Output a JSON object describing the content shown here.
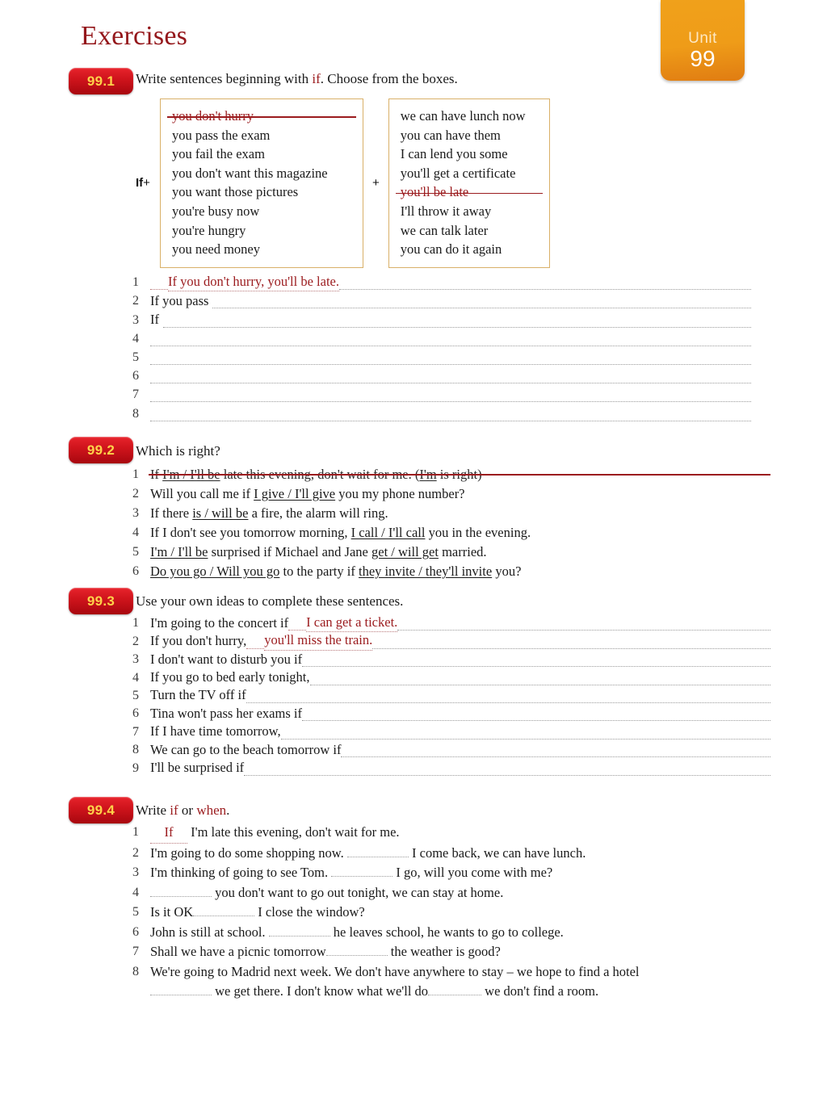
{
  "unit": {
    "word": "Unit",
    "number": "99"
  },
  "page": {
    "title": "Exercises"
  },
  "colors": {
    "title_red": "#94171b",
    "badge_red": "#cf141c",
    "badge_text_gold": "#ffd24a",
    "unit_orange": "#ef9c18",
    "box_border_gold": "#d9b068",
    "answer_red": "#9b1b1e"
  },
  "ex1": {
    "number": "99.1",
    "instruction_pre": "Write sentences beginning with ",
    "instruction_keyword": "if",
    "instruction_post": ".  Choose from the boxes.",
    "if_label": "If",
    "plus": "+",
    "mid_plus": "+",
    "left_box": [
      {
        "text": "you don't hurry",
        "struck": true
      },
      {
        "text": "you pass the exam",
        "struck": false
      },
      {
        "text": "you fail the exam",
        "struck": false
      },
      {
        "text": "you don't want this magazine",
        "struck": false
      },
      {
        "text": "you want those pictures",
        "struck": false
      },
      {
        "text": "you're busy now",
        "struck": false
      },
      {
        "text": "you're hungry",
        "struck": false
      },
      {
        "text": "you need money",
        "struck": false
      }
    ],
    "right_box": [
      {
        "text": "we can have lunch now",
        "struck": false
      },
      {
        "text": "you can have them",
        "struck": false
      },
      {
        "text": "I can lend you some",
        "struck": false
      },
      {
        "text": "you'll get a certificate",
        "struck": false
      },
      {
        "text": "you'll be late",
        "struck": true
      },
      {
        "text": "I'll throw it away",
        "struck": false
      },
      {
        "text": "we can talk later",
        "struck": false
      },
      {
        "text": "you can do it again",
        "struck": false
      }
    ],
    "items": [
      {
        "n": "1",
        "prompt": "",
        "answer": "If you don't hurry, you'll be late."
      },
      {
        "n": "2",
        "prompt": "If you pass",
        "answer": ""
      },
      {
        "n": "3",
        "prompt": "If",
        "answer": ""
      },
      {
        "n": "4",
        "prompt": "",
        "answer": ""
      },
      {
        "n": "5",
        "prompt": "",
        "answer": ""
      },
      {
        "n": "6",
        "prompt": "",
        "answer": ""
      },
      {
        "n": "7",
        "prompt": "",
        "answer": ""
      },
      {
        "n": "8",
        "prompt": "",
        "answer": ""
      }
    ]
  },
  "ex2": {
    "number": "99.2",
    "instruction": "Which is right?",
    "items": [
      {
        "n": "1",
        "struck": true,
        "parts": [
          {
            "t": "If ",
            "u": false
          },
          {
            "t": "I'm /  I'll be",
            "u": true
          },
          {
            "t": " late this evening, don't wait for me.     (",
            "u": false
          },
          {
            "t": "I'm",
            "u": true
          },
          {
            "t": " is right)",
            "u": false
          }
        ]
      },
      {
        "n": "2",
        "struck": false,
        "parts": [
          {
            "t": "Will you call me if ",
            "u": false
          },
          {
            "t": "I give / I'll give",
            "u": true
          },
          {
            "t": " you my phone number?",
            "u": false
          }
        ]
      },
      {
        "n": "3",
        "struck": false,
        "parts": [
          {
            "t": "If there ",
            "u": false
          },
          {
            "t": "is / will be",
            "u": true
          },
          {
            "t": " a fire, the alarm will ring.",
            "u": false
          }
        ]
      },
      {
        "n": "4",
        "struck": false,
        "parts": [
          {
            "t": "If I don't see you tomorrow morning, ",
            "u": false
          },
          {
            "t": "I call / I'll call",
            "u": true
          },
          {
            "t": " you in the evening.",
            "u": false
          }
        ]
      },
      {
        "n": "5",
        "struck": false,
        "parts": [
          {
            "t": "I'm / I'll be",
            "u": true
          },
          {
            "t": " surprised if Michael and Jane ",
            "u": false
          },
          {
            "t": "get / will get",
            "u": true
          },
          {
            "t": " married.",
            "u": false
          }
        ]
      },
      {
        "n": "6",
        "struck": false,
        "parts": [
          {
            "t": "Do you go / Will you go",
            "u": true
          },
          {
            "t": " to the party if ",
            "u": false
          },
          {
            "t": "they invite / they'll invite",
            "u": true
          },
          {
            "t": " you?",
            "u": false
          }
        ]
      }
    ]
  },
  "ex3": {
    "number": "99.3",
    "instruction": "Use your own ideas to complete these sentences.",
    "items": [
      {
        "n": "1",
        "prompt": "I'm going to the concert if",
        "answer": "I can get a ticket."
      },
      {
        "n": "2",
        "prompt": "If you don't hurry,",
        "answer": "you'll miss the train."
      },
      {
        "n": "3",
        "prompt": "I don't want to disturb you if",
        "answer": ""
      },
      {
        "n": "4",
        "prompt": "If you go to bed early tonight,",
        "answer": ""
      },
      {
        "n": "5",
        "prompt": "Turn the TV off if",
        "answer": ""
      },
      {
        "n": "6",
        "prompt": "Tina won't pass her exams if",
        "answer": ""
      },
      {
        "n": "7",
        "prompt": "If I have time tomorrow,",
        "answer": ""
      },
      {
        "n": "8",
        "prompt": "We can go to the beach tomorrow if",
        "answer": ""
      },
      {
        "n": "9",
        "prompt": "I'll be surprised if",
        "answer": ""
      }
    ]
  },
  "ex4": {
    "number": "99.4",
    "instruction_pre": "Write ",
    "instruction_kw1": "if",
    "instruction_mid": " or ",
    "instruction_kw2": "when",
    "instruction_post": ".",
    "items": [
      {
        "n": "1",
        "fill": "If",
        "before": "",
        "after": "I'm late this evening, don't wait for me.",
        "tail": ""
      },
      {
        "n": "2",
        "fill": "",
        "before": "I'm going to do some shopping now.  ",
        "after": "I come back, we can have lunch.",
        "tail": ""
      },
      {
        "n": "3",
        "fill": "",
        "before": "I'm thinking of going to see Tom.  ",
        "after": "I go, will you come with me?",
        "tail": ""
      },
      {
        "n": "4",
        "fill": "",
        "before": "",
        "after": "you don't want to go out tonight, we can stay at home.",
        "tail": ""
      },
      {
        "n": "5",
        "fill": "",
        "before": "Is it OK",
        "after": "I close the window?",
        "tail": ""
      },
      {
        "n": "6",
        "fill": "",
        "before": "John is still at school.  ",
        "after": "he leaves school, he wants to go to college.",
        "tail": ""
      },
      {
        "n": "7",
        "fill": "",
        "before": "Shall we have a picnic tomorrow",
        "after": "the weather is good?",
        "tail": ""
      },
      {
        "n": "8",
        "fill": "",
        "before": "We're going to Madrid next week.  We don't have anywhere to stay – we hope to find a hotel",
        "after": "",
        "tail": ""
      }
    ],
    "item8_line2_a": "we get there.  I don't know what we'll do",
    "item8_line2_b": "we don't find a room."
  }
}
